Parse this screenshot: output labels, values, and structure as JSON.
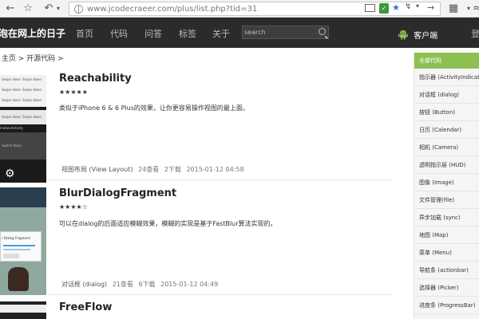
{
  "browser": {
    "url": "www.jcodecraeer.com/plus/list.php?tid=31"
  },
  "header": {
    "title": "泡在网上的日子",
    "nav": [
      "首页",
      "代码",
      "问答",
      "标签",
      "关于"
    ],
    "search_placeholder": "search",
    "android_label": "客户端",
    "right_label": "登"
  },
  "breadcrumb": ": 主页 > 开源代码 >",
  "items": [
    {
      "title": "Reachability",
      "stars": "★★★★★",
      "description": "类似于iPhone 6 & 6 Plus的效果，让你更容易操作视图的最上面。",
      "category": "视图布局 (View Layout)",
      "views": "24查看",
      "downloads": "2下载",
      "date": "2015-01-12 04:58",
      "thumb_text": [
        "Swipe down",
        "Swipe down",
        "Swipe down",
        "Swipe down",
        "Swipe down",
        "Swipe down",
        "Swipe down",
        "Swipe down",
        "Swipe down",
        "mationActivity",
        "Switch Rows"
      ]
    },
    {
      "title": "BlurDialogFragment",
      "stars": "★★★★☆",
      "description": "可以在dialog的后面适应模糊效果，模糊的实现是基于FastBlur算法实现的。",
      "category": "对话框 (dialog)",
      "views": "21查看",
      "downloads": "6下载",
      "date": "2015-01-12 04:49",
      "thumb_text": [
        "r Dialog Fragment"
      ]
    },
    {
      "title": "FreeFlow"
    }
  ],
  "sidebar": {
    "header": "全部代码",
    "items": [
      "指示器 (ActivityIndicator)",
      "对话框 (dialog)",
      "按钮 (Button)",
      "日历 (Calendar)",
      "相机 (Camera)",
      "透明指示层 (HUD)",
      "图像 (Image)",
      "文件管理(file)",
      "异步加载 (sync)",
      "地图 (Map)",
      "菜单 (Menu)",
      "导航条 (actionbar)",
      "选择器 (Picker)",
      "进度条 (ProgressBar)"
    ]
  },
  "colors": {
    "header_bg": "#2b2b2b",
    "sidebar_header": "#8cc152",
    "android_green": "#8cc152"
  }
}
